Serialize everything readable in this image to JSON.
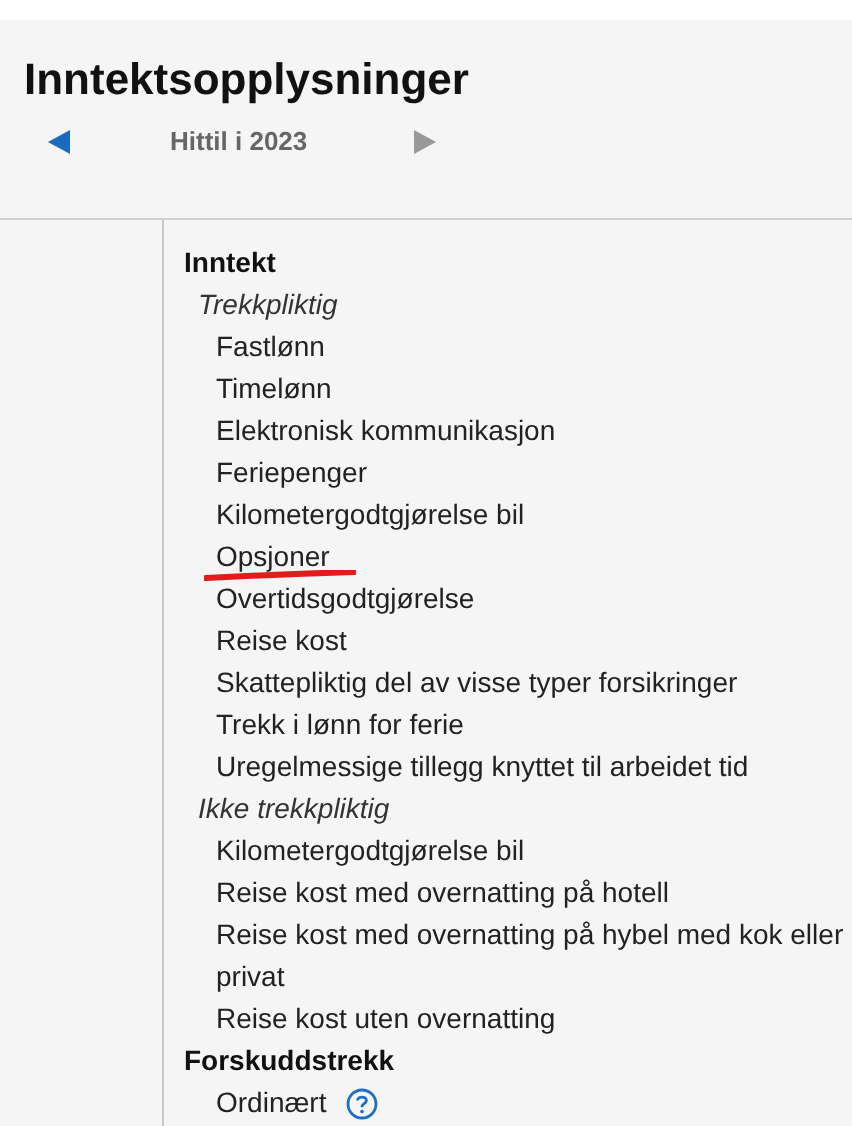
{
  "header": {
    "title": "Inntektsopplysninger",
    "period": "Hittil i 2023",
    "prev_enabled": true,
    "next_enabled": false
  },
  "sections": [
    {
      "heading": "Inntekt",
      "children": [
        {
          "kind": "group",
          "label": "Trekkpliktig",
          "children": [
            {
              "kind": "item",
              "label": "Fastlønn",
              "underlined": false
            },
            {
              "kind": "item",
              "label": "Timelønn",
              "underlined": false
            },
            {
              "kind": "item",
              "label": "Elektronisk kommunikasjon",
              "underlined": false
            },
            {
              "kind": "item",
              "label": "Feriepenger",
              "underlined": false
            },
            {
              "kind": "item",
              "label": "Kilometergodtgjørelse bil",
              "underlined": false
            },
            {
              "kind": "item",
              "label": "Opsjoner",
              "underlined": true
            },
            {
              "kind": "item",
              "label": "Overtidsgodtgjørelse",
              "underlined": false
            },
            {
              "kind": "item",
              "label": "Reise kost",
              "underlined": false
            },
            {
              "kind": "item",
              "label": "Skattepliktig del av visse typer forsikringer",
              "underlined": false
            },
            {
              "kind": "item",
              "label": "Trekk i lønn for ferie",
              "underlined": false
            },
            {
              "kind": "item",
              "label": "Uregelmessige tillegg knyttet til arbeidet tid",
              "underlined": false
            }
          ]
        },
        {
          "kind": "group",
          "label": "Ikke trekkpliktig",
          "children": [
            {
              "kind": "item",
              "label": "Kilometergodtgjørelse bil",
              "underlined": false
            },
            {
              "kind": "item",
              "label": "Reise kost med overnatting på hotell",
              "underlined": false
            },
            {
              "kind": "item",
              "label": "Reise kost med overnatting på hybel med kok eller privat",
              "underlined": false
            },
            {
              "kind": "item",
              "label": "Reise kost uten overnatting",
              "underlined": false
            }
          ]
        }
      ]
    },
    {
      "heading": "Forskuddstrekk",
      "children": [
        {
          "kind": "help-item",
          "label": "Ordinært",
          "underlined": false
        }
      ]
    }
  ]
}
